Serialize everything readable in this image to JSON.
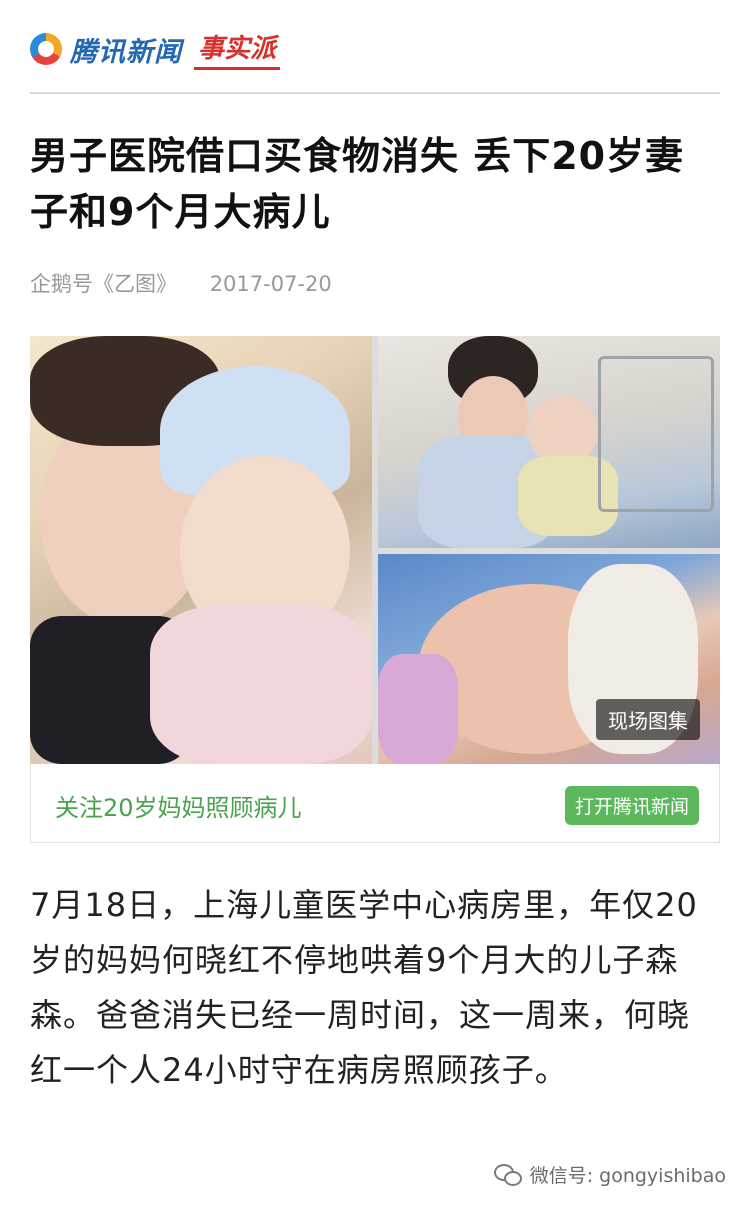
{
  "header": {
    "brand": "腾讯新闻",
    "column": "事实派"
  },
  "article": {
    "title": "男子医院借口买食物消失 丢下20岁妻子和9个月大病儿",
    "source": "企鹅号《乙图》",
    "date": "2017-07-20",
    "gallery": {
      "badge": "现场图集",
      "caption": "关注20岁妈妈照顾病儿",
      "open_app_label": "打开腾讯新闻"
    },
    "body": "7月18日，上海儿童医学中心病房里，年仅20岁的妈妈何晓红不停地哄着9个月大的儿子森森。爸爸消失已经一周时间，这一周来，何晓红一个人24小时守在病房照顾孩子。"
  },
  "watermark": {
    "text": "微信号: gongyishibao"
  }
}
